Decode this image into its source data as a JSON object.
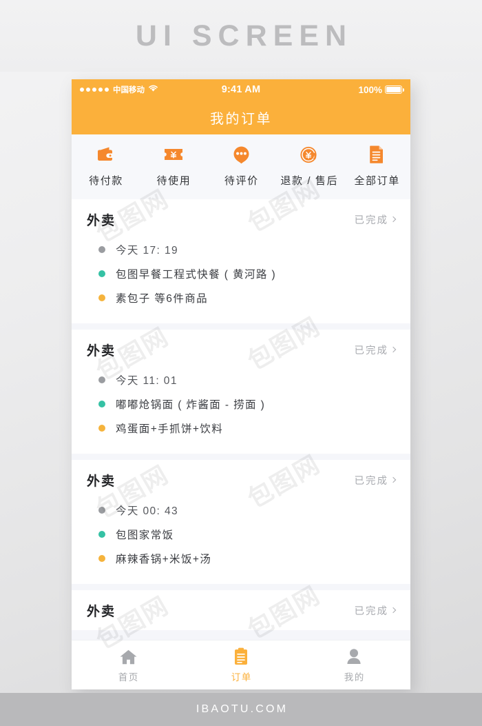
{
  "banner": {
    "title": "UI SCREEN"
  },
  "footer": {
    "text": "IBAOTU.COM"
  },
  "colors": {
    "brand_orange": "#fbb03b",
    "icon_orange": "#f5882d",
    "dot_grey": "#9a9ca0",
    "dot_teal": "#35c1a4",
    "dot_amber": "#f5b33c",
    "card_white": "#ffffff",
    "page_bg": "#f5f6fa",
    "text_dark": "#222326",
    "text_muted": "#a9abb0"
  },
  "statusbar": {
    "carrier": "中国移动",
    "wifi_icon": "wifi-icon",
    "time": "9:41 AM",
    "battery_level": "100%",
    "signal_dots": 5
  },
  "header": {
    "title": "我的订单"
  },
  "categories": [
    {
      "icon": "wallet-icon",
      "label": "待付款"
    },
    {
      "icon": "coupon-ticket-icon",
      "label": "待使用"
    },
    {
      "icon": "comment-bubble-icon",
      "label": "待评价"
    },
    {
      "icon": "refund-circle-icon",
      "label": "退款 / 售后"
    },
    {
      "icon": "document-icon",
      "label": "全部订单"
    }
  ],
  "orders": [
    {
      "type": "外卖",
      "status": "已完成",
      "time": "今天  17: 19",
      "shop": "包图早餐工程式快餐 ( 黄河路 )",
      "items": "素包子  等6件商品"
    },
    {
      "type": "外卖",
      "status": "已完成",
      "time": "今天  11: 01",
      "shop": "嘟嘟炝锅面 ( 炸酱面 - 捞面 )",
      "items": "鸡蛋面+手抓饼+饮料"
    },
    {
      "type": "外卖",
      "status": "已完成",
      "time": "今天  00: 43",
      "shop": "包图家常饭",
      "items": "麻辣香锅+米饭+汤"
    },
    {
      "type": "外卖",
      "status": "已完成",
      "time": "",
      "shop": "",
      "items": ""
    }
  ],
  "tabbar": [
    {
      "icon": "home-icon",
      "label": "首页",
      "active": false
    },
    {
      "icon": "clipboard-order-icon",
      "label": "订单",
      "active": true
    },
    {
      "icon": "person-icon",
      "label": "我的",
      "active": false
    }
  ],
  "watermark": {
    "text": "包图网"
  }
}
